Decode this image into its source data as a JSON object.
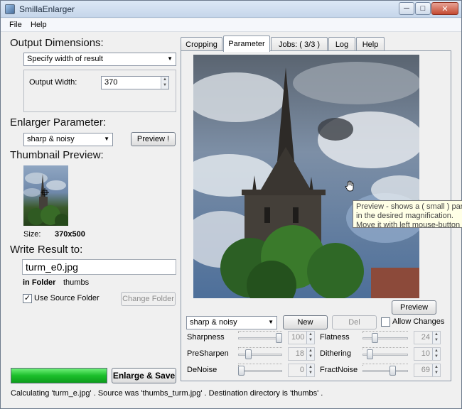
{
  "window": {
    "title": "SmillaEnlarger",
    "controls": {
      "minimize": "─",
      "maximize": "□",
      "close": "✕"
    },
    "icon": "app-icon"
  },
  "menu": {
    "file": "File",
    "help": "Help"
  },
  "output_dimensions": {
    "title": "Output Dimensions:",
    "mode_selected": "Specify width of result",
    "width_label": "Output Width:",
    "width_value": "370"
  },
  "enlarger_parameter": {
    "title": "Enlarger Parameter:",
    "preset_selected": "sharp & noisy",
    "preview_button": "Preview !"
  },
  "thumbnail": {
    "title": "Thumbnail Preview:",
    "size_label": "Size:",
    "size_value": "370x500"
  },
  "write_result": {
    "title": "Write Result to:",
    "filename": "turm_e0.jpg",
    "folder_label": "in Folder",
    "folder_value": "thumbs",
    "use_source_folder_label": "Use Source Folder",
    "use_source_folder_checked": true,
    "change_folder_button": "Change Folder"
  },
  "enlarge": {
    "progress": 1.0,
    "button": "Enlarge & Save"
  },
  "status_text": "Calculating 'turm_e.jpg' .  Source was 'thumbs_turm.jpg' .  Destination directory is 'thumbs' .",
  "tabs": [
    {
      "label": "Cropping",
      "active": false
    },
    {
      "label": "Parameter",
      "active": true
    },
    {
      "label": "Jobs: ( 3/3 )",
      "active": false
    },
    {
      "label": "Log",
      "active": false
    },
    {
      "label": "Help",
      "active": false
    }
  ],
  "preview_panel": {
    "tooltip_line1": "Preview - shows a ( small ) part of",
    "tooltip_line2": "in the desired magnification.",
    "tooltip_line3": "Move it with left mouse-button",
    "preview_button": "Preview",
    "cursor_icon": "hand-cursor-icon"
  },
  "parameters": {
    "preset_selected": "sharp & noisy",
    "new_button": "New",
    "del_button": "Del",
    "allow_changes_label": "Allow Changes",
    "allow_changes_checked": false,
    "sliders": [
      {
        "label": "Sharpness",
        "value": "100",
        "level": 1.0
      },
      {
        "label": "PreSharpen",
        "value": "18",
        "level": 0.18
      },
      {
        "label": "DeNoise",
        "value": "0",
        "level": 0.0
      },
      {
        "label": "Flatness",
        "value": "24",
        "level": 0.24
      },
      {
        "label": "Dithering",
        "value": "10",
        "level": 0.1
      },
      {
        "label": "FractNoise",
        "value": "69",
        "level": 0.69
      }
    ]
  }
}
